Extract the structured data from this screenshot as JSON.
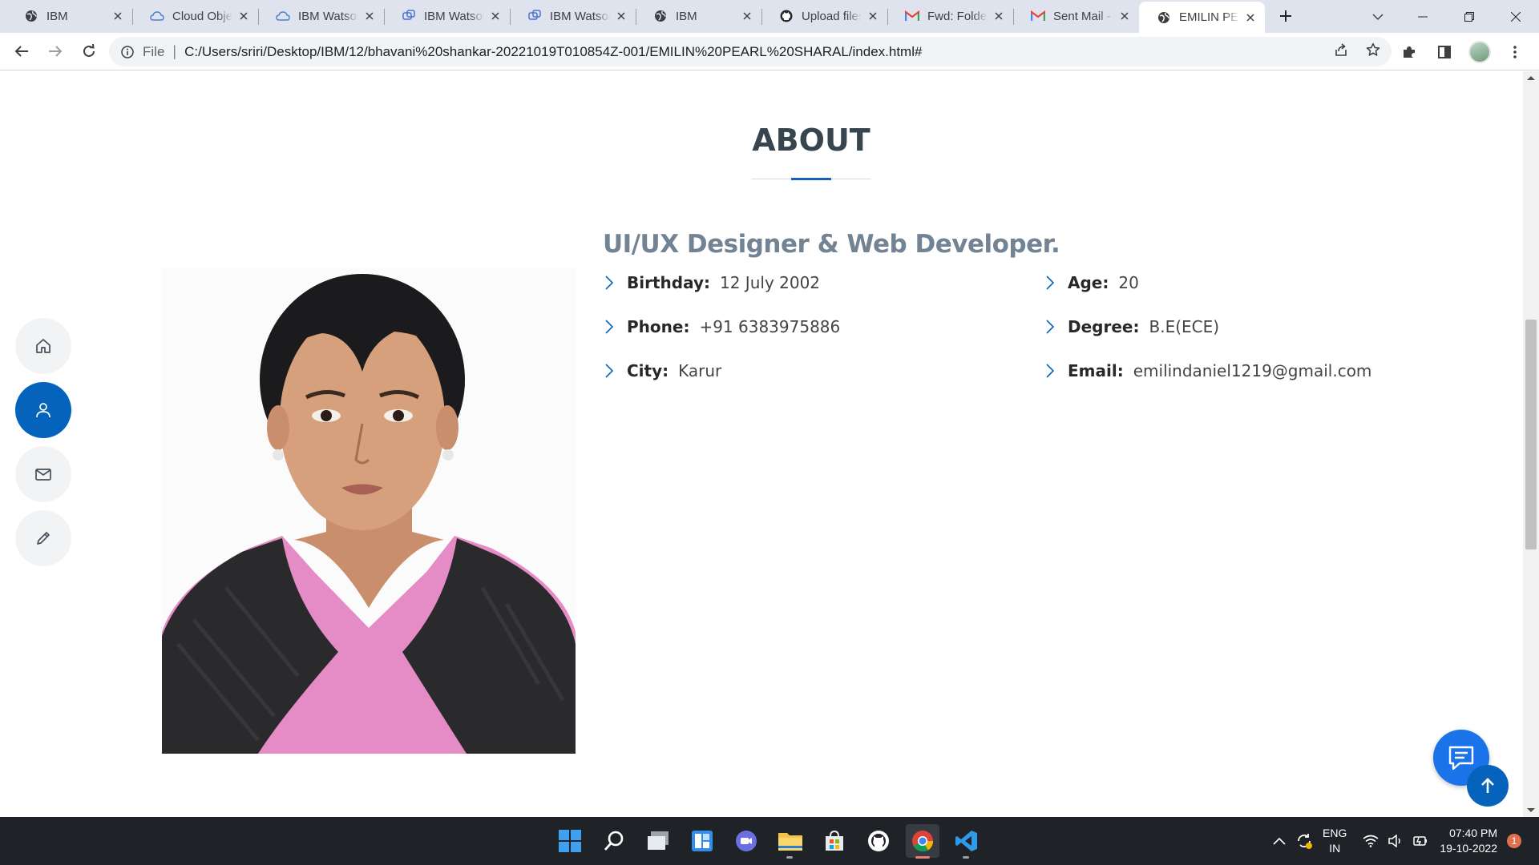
{
  "browser": {
    "tabs": [
      {
        "title": "IBM",
        "icon": "globe-icon"
      },
      {
        "title": "Cloud Object Storage",
        "icon": "cloud-icon"
      },
      {
        "title": "IBM Watson Assistant",
        "icon": "cloud-icon"
      },
      {
        "title": "IBM Watson Assistant",
        "icon": "watson-icon"
      },
      {
        "title": "IBM Watson Assistant",
        "icon": "watson-icon"
      },
      {
        "title": "IBM",
        "icon": "globe-icon"
      },
      {
        "title": "Upload files",
        "icon": "github-icon"
      },
      {
        "title": "Fwd: Folder",
        "icon": "gmail-icon"
      },
      {
        "title": "Sent Mail -",
        "icon": "gmail-icon"
      },
      {
        "title": "EMILIN PEARL SHARAL",
        "icon": "globe-icon"
      }
    ],
    "active_tab": 9,
    "file_label": "File",
    "url": "C:/Users/sriri/Desktop/IBM/12/bhavani%20shankar-20221019T010854Z-001/EMILIN%20PEARL%20SHARAL/index.html#"
  },
  "about": {
    "title": "ABOUT",
    "role": "UI/UX Designer & Web Developer.",
    "left": [
      {
        "label": "Birthday:",
        "value": "12 July 2002"
      },
      {
        "label": "Phone:",
        "value": "+91 6383975886"
      },
      {
        "label": "City:",
        "value": "Karur"
      }
    ],
    "right": [
      {
        "label": "Age:",
        "value": "20"
      },
      {
        "label": "Degree:",
        "value": "B.E(ECE)"
      },
      {
        "label": "Email:",
        "value": "emilindaniel1219@gmail.com"
      }
    ]
  },
  "sidenav": [
    "home-icon",
    "person-icon",
    "mail-icon",
    "pencil-icon"
  ],
  "colors": {
    "accent": "#0563bb",
    "heading": "#37454f",
    "role": "#728394",
    "taskbar": "#1f2328",
    "tabstrip": "#dfe3ee"
  },
  "taskbar": {
    "lang_top": "ENG",
    "lang_bottom": "IN",
    "time": "07:40 PM",
    "date": "19-10-2022",
    "notifications": "1"
  }
}
